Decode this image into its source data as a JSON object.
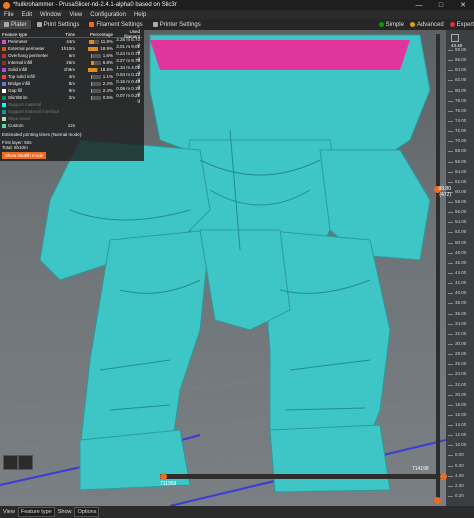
{
  "window": {
    "title": "*hulkrohammer - PrusaSlicer-nd-2.4.1-alpha0 based on Slic3r",
    "controls": [
      "—",
      "□",
      "✕"
    ]
  },
  "menu": [
    "File",
    "Edit",
    "Window",
    "View",
    "Configuration",
    "Help"
  ],
  "tabs": [
    {
      "label": "Plater",
      "icon": "plater-icon"
    },
    {
      "label": "Print Settings",
      "icon": "print-settings-icon"
    },
    {
      "label": "Filament Settings",
      "icon": "filament-settings-icon"
    },
    {
      "label": "Printer Settings",
      "icon": "printer-settings-icon"
    }
  ],
  "modes": [
    {
      "label": "Simple",
      "color": "#00a000"
    },
    {
      "label": "Advanced",
      "color": "#e0a000"
    },
    {
      "label": "Expert",
      "color": "#e03030"
    }
  ],
  "legend": {
    "headers": {
      "type": "Feature type",
      "time": "Time",
      "percent": "Percentage",
      "used": "Used filament"
    },
    "rows": [
      {
        "name": "Perimeter",
        "color": "#d94ec8",
        "time": "44m",
        "pct": "11.8%",
        "used": "2.25 m",
        "weight": "6.73 g",
        "frac": 0.118,
        "dim": false
      },
      {
        "name": "External perimeter",
        "color": "#d2531d",
        "time": "1h10m",
        "pct": "18.9%",
        "used": "3.01 m",
        "weight": "9.01 g",
        "frac": 0.189,
        "dim": false
      },
      {
        "name": "Overhang perimeter",
        "color": "#c02f2f",
        "time": "6m",
        "pct": "1.6%",
        "used": "0.24 m",
        "weight": "0.72 g",
        "frac": 0.016,
        "dim": false
      },
      {
        "name": "Internal infill",
        "color": "#8a2f2f",
        "time": "26m",
        "pct": "6.8%",
        "used": "3.27 m",
        "weight": "9.78 g",
        "frac": 0.068,
        "dim": false
      },
      {
        "name": "Solid infill",
        "color": "#b04ddb",
        "time": "1h9m",
        "pct": "18.5%",
        "used": "1.34 m",
        "weight": "4.01 g",
        "frac": 0.185,
        "dim": false
      },
      {
        "name": "Top solid infill",
        "color": "#f0403e",
        "time": "4m",
        "pct": "1.1%",
        "used": "0.04 m",
        "weight": "0.12 g",
        "frac": 0.011,
        "dim": false
      },
      {
        "name": "Bridge infill",
        "color": "#5a7fd9",
        "time": "8m",
        "pct": "2.2%",
        "used": "0.16 m",
        "weight": "0.48 g",
        "frac": 0.022,
        "dim": false
      },
      {
        "name": "Gap fill",
        "color": "#ffffff",
        "time": "9m",
        "pct": "2.4%",
        "used": "0.06 m",
        "weight": "0.18 g",
        "frac": 0.024,
        "dim": false
      },
      {
        "name": "Skirt/Brim",
        "color": "#00875a",
        "time": "2m",
        "pct": "0.5%",
        "used": "0.07 m",
        "weight": "0.21 g",
        "frac": 0.005,
        "dim": false
      },
      {
        "name": "Support material",
        "color": "#00ffff",
        "time": "",
        "pct": "",
        "used": "",
        "weight": "",
        "frac": 0,
        "dim": true
      },
      {
        "name": "Support material interface",
        "color": "#00a0a0",
        "time": "",
        "pct": "",
        "used": "",
        "weight": "",
        "frac": 0,
        "dim": true
      },
      {
        "name": "Wipe tower",
        "color": "#b3e3ab",
        "time": "",
        "pct": "",
        "used": "",
        "weight": "",
        "frac": 0,
        "dim": true
      },
      {
        "name": "Custom",
        "color": "#5fd8a9",
        "time": "12s",
        "pct": "",
        "used": "",
        "weight": "",
        "frac": 0,
        "dim": false
      }
    ],
    "estimated_label": "Estimated printing times (Normal mode):",
    "first_layer": "First layer:  50s",
    "total": "Total:  6h10m",
    "stealth_button": "Show stealth mode"
  },
  "vslider": {
    "top_value": "43.40",
    "current_value": "98.80",
    "current_layer": "(472)",
    "ticks": [
      "88.00",
      "86.00",
      "84.00",
      "82.00",
      "80.00",
      "78.00",
      "76.00",
      "74.00",
      "72.00",
      "70.00",
      "68.00",
      "66.00",
      "64.00",
      "62.00",
      "60.00",
      "58.00",
      "56.00",
      "54.00",
      "52.00",
      "50.00",
      "48.00",
      "46.00",
      "44.00",
      "42.00",
      "40.00",
      "38.00",
      "36.00",
      "34.00",
      "32.00",
      "30.00",
      "28.00",
      "26.00",
      "24.00",
      "22.00",
      "20.00",
      "18.00",
      "16.00",
      "14.00",
      "12.00",
      "10.00",
      "8.00",
      "6.00",
      "4.00",
      "2.00",
      "0.20"
    ]
  },
  "hslider": {
    "left_value": "711959",
    "right_value": "714198"
  },
  "bottombar": {
    "view_label": "View",
    "view_value": "Feature type",
    "show_label": "Show",
    "show_value": "Options"
  },
  "colors": {
    "accent": "#ed6b21",
    "model": "#3ec6c6",
    "model_top": "#e0359a"
  }
}
